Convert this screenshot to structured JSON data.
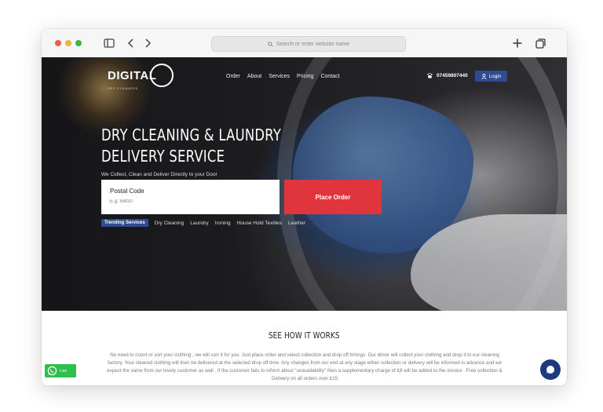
{
  "browser": {
    "url_placeholder": "Search or enter website name",
    "icons": [
      "sidebar-icon",
      "back-icon",
      "forward-icon",
      "search-icon",
      "new-tab-icon",
      "tabs-icon"
    ]
  },
  "site": {
    "logo_text": "DIGITAL",
    "logo_tagline": "DRY CLEANERS",
    "nav": [
      "Order",
      "About",
      "Services",
      "Pricing",
      "Contact"
    ],
    "phone": "07459807440",
    "login_label": "Login"
  },
  "hero": {
    "headline_line1": "DRY CLEANING & LAUNDRY",
    "headline_line2": "DELIVERY SERVICE",
    "subline": "We Collect, Clean and Deliver Directly to your Door",
    "postal_label": "Postal Code",
    "postal_placeholder": "E.g: SW20",
    "place_order_label": "Place Order",
    "trending_label": "Trending Services",
    "trending_items": [
      "Dry Cleaning",
      "Laundry",
      "Ironing",
      "House Hold Textiles",
      "Leather"
    ]
  },
  "how": {
    "title": "SEE HOW IT WORKS",
    "paragraph": "No need to count or sort your clothing , we will sort it for you. Just place order and select collection and drop off timings. Our driver will collect your clothing and drop it to our cleaning factory. Your cleaned clothing will then be delivered at the selected drop off time. Any changes from our end at any stage either collection or delivery will be informed in advance and we expect the same from our lovely customer as well . If the customer fails to inform about \"unavailability\" then a supplementary charge of £8 will be added to the invoice . Free collection & Delivery on all orders over £15"
  },
  "widgets": {
    "whatsapp_label": "Live",
    "colors": {
      "accent_blue": "#2f4c92",
      "order_red": "#e0353d",
      "whatsapp_green": "#2ec04c"
    }
  }
}
